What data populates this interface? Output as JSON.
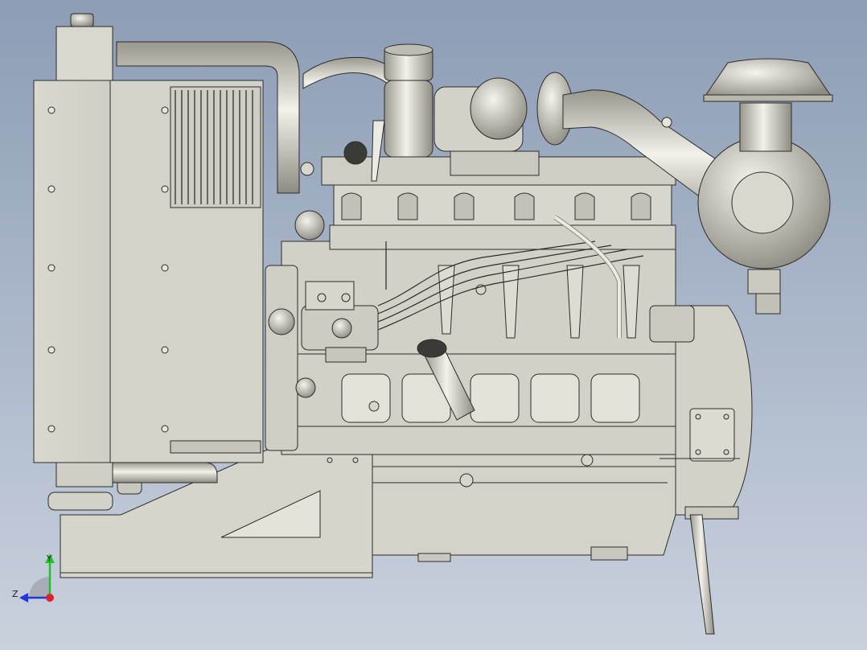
{
  "viewport": {
    "background_top": "#8d9db5",
    "background_bottom": "#c9d1dd",
    "model_fill": "#d7d6cc",
    "model_stroke": "#2c2c2a"
  },
  "triad": {
    "y_label": "Y",
    "z_label": "Z",
    "y_color": "#22c22a",
    "z_color": "#2436d9",
    "x_color": "#e0202a"
  }
}
